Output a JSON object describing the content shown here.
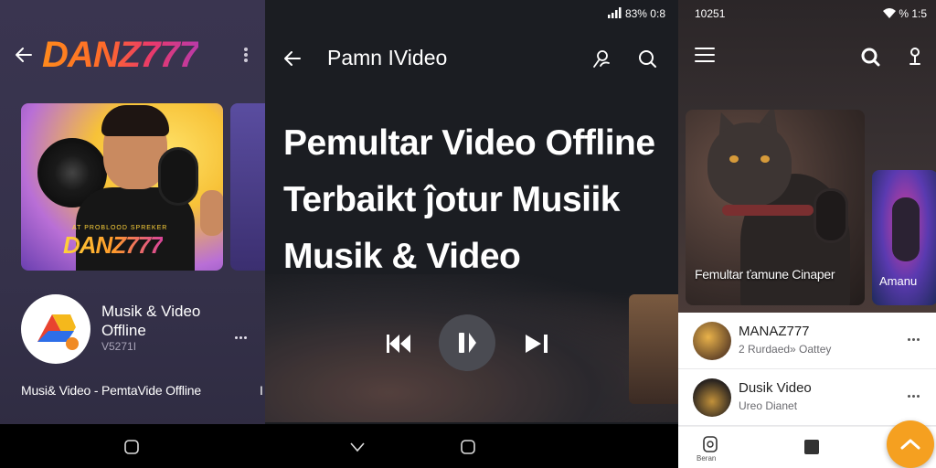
{
  "panel1": {
    "brand": "DANZ777",
    "hero_logo_small": "AT PROBLOOD SPREKER",
    "hero_logo": "DANZ777",
    "app_title": "Musik & Video Offline",
    "app_version": "V5271I",
    "caption": "Musi& Video - PemtaVide Offline",
    "caption_edge": "I"
  },
  "panel2": {
    "status": "83% 0:8",
    "title": "Pamn IVideo",
    "headline": [
      "Pemultar Video Offline",
      "Terbaikt ĵotur Musiik",
      "Musik & Video"
    ]
  },
  "panel3": {
    "status_left": "10251",
    "status_right": "% 1:5",
    "card1_caption": "Femultar ťamune Cinaper",
    "card2_caption": "Amanu",
    "list": [
      {
        "title": "MANAZ777",
        "subtitle": "2 Rurdaed» Oattey"
      },
      {
        "title": "Dusik Video",
        "subtitle": "Ureo Dianet"
      }
    ],
    "bottom_label": "Beran"
  },
  "colors": {
    "brand_orange": "#ff8a1c",
    "fab": "#f5a020",
    "panel1_bg": "#35314a",
    "panel2_bg": "#1b1d22"
  }
}
